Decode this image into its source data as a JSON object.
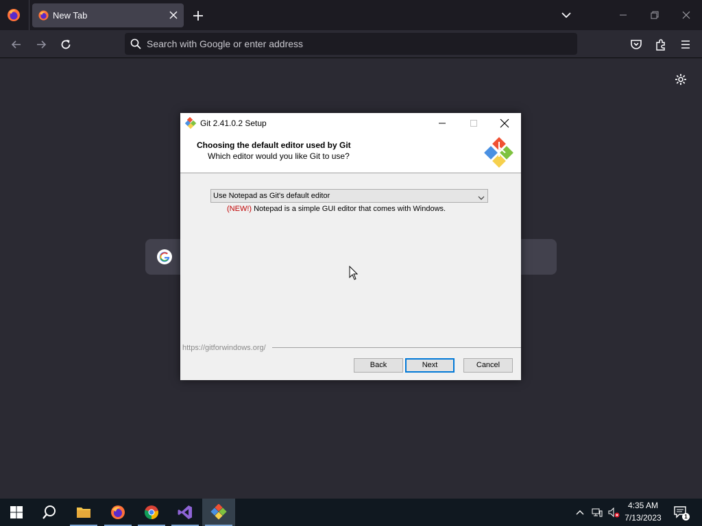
{
  "browser": {
    "tab": {
      "title": "New Tab"
    },
    "urlbar": {
      "placeholder": "Search with Google or enter address"
    },
    "accent": "#42414d"
  },
  "dialog": {
    "title": "Git 2.41.0.2 Setup",
    "header_title": "Choosing the default editor used by Git",
    "header_subtitle": "Which editor would you like Git to use?",
    "editor_select": {
      "selected": "Use Notepad as Git's default editor"
    },
    "description_new_tag": "(NEW!)",
    "description_text": " Notepad is a simple GUI editor that comes with Windows.",
    "footer_link": "https://gitforwindows.org/",
    "buttons": {
      "back": "Back",
      "next": "Next",
      "cancel": "Cancel"
    }
  },
  "taskbar": {
    "apps": [
      "start-icon",
      "search-icon",
      "file-explorer-icon",
      "firefox-icon",
      "chrome-icon",
      "visual-studio-icon",
      "git-icon"
    ],
    "time": "4:35 AM",
    "date": "7/13/2023",
    "notification_count": "1"
  }
}
